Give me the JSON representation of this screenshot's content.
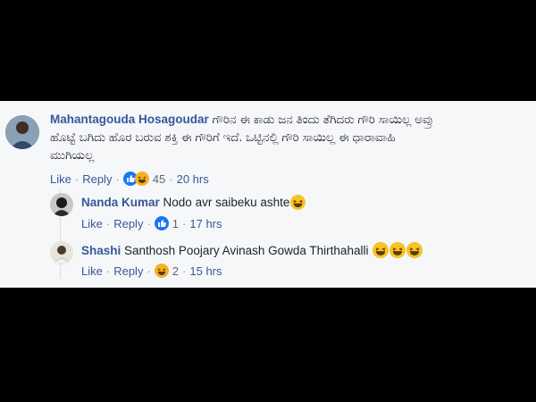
{
  "comments": [
    {
      "author": "Mahantagouda Hosagoudar",
      "text": "ಗೌರಿನ ಈ ಕಾಡು ಜನ ತಿಂದು ತೆಗಿದರು ಗೌರಿ ಸಾಯಿಲ್ಲ ಅವ್ರು",
      "text_line2": "ಹೊಟ್ಟೆ ಬಗಿದು ಹೊರ ಬರುವ ಶಕ್ತಿ ಈ ಗೌರಿಗೆ ಇದೆ. ಒಟ್ಟಿನಲ್ಲಿ ಗೌರಿ ಸಾಯಿಲ್ಲ ಈ ಧಾರಾವಾಹಿ",
      "text_line3": "ಮುಗಿಯಲ್ಲ",
      "like_label": "Like",
      "separator": "·",
      "reply_label": "Reply",
      "reaction_count": "45",
      "time": "20 hrs"
    },
    {
      "author": "Nanda Kumar",
      "text": "Nodo avr saibeku ashte",
      "like_label": "Like",
      "separator": "·",
      "reply_label": "Reply",
      "reaction_count": "1",
      "time": "17 hrs"
    },
    {
      "author": "Shashi",
      "text": "Santhosh Poojary Avinash Gowda Thirthahalli",
      "like_label": "Like",
      "separator": "·",
      "reply_label": "Reply",
      "reaction_count": "2",
      "time": "15 hrs"
    }
  ],
  "colors": {
    "background": "#000000",
    "panel": "#f6f7f9",
    "name": "#365899",
    "link": "#385898",
    "meta": "#606770",
    "like_blue": "#1877f2",
    "haha_yellow": "#f7b125"
  },
  "icons": {
    "like_reaction": "like-reaction-icon",
    "haha_reaction": "haha-reaction-icon",
    "laughing_emoji": "laughing-emoji-icon"
  }
}
